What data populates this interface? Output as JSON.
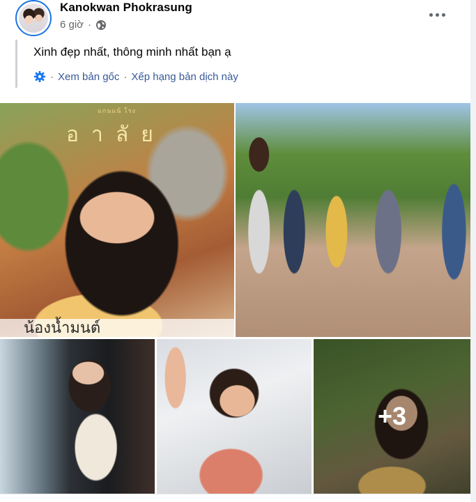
{
  "post": {
    "author": "Kanokwan Phokrasung",
    "time": "6 giờ",
    "privacy_icon": "globe-icon",
    "more_icon": "more-horizontal-icon"
  },
  "translation": {
    "text": "Xinh đẹp nhất, thông minh nhất bạn ạ",
    "settings_icon": "gear-icon",
    "see_original": "Xem bản gốc",
    "separator": "·",
    "rate": "Xếp hạng bản dịch này"
  },
  "photos": {
    "photo1_title": "อาลัย",
    "photo1_small": "แกนแน้ โรง",
    "photo1_caption": "น้องน้ำมนต์",
    "more_count": "+3"
  },
  "colors": {
    "link": "#385898",
    "secondary_text": "#65676b",
    "settings_icon": "#1877f2"
  }
}
